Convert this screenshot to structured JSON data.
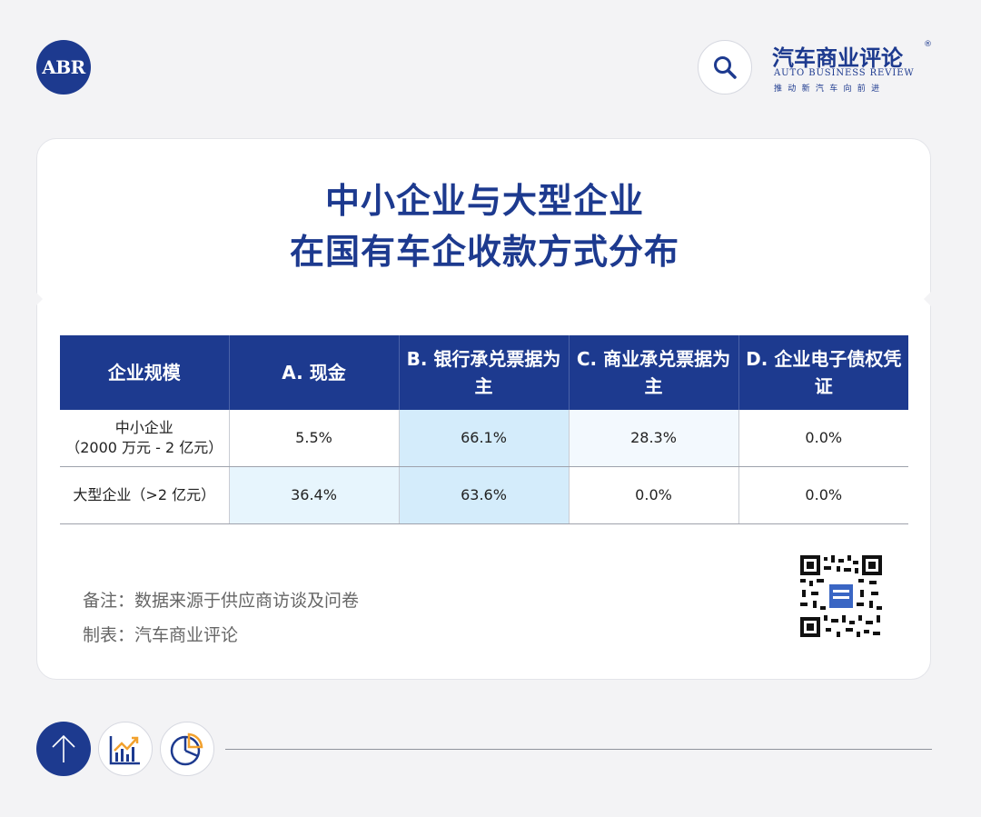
{
  "header": {
    "logo_text": "ABR",
    "brand_name": "汽车商业评论",
    "brand_registered": "®",
    "brand_english": "AUTO BUSINESS REVIEW",
    "brand_slogan": "推动新汽车向前进"
  },
  "card": {
    "title_line1": "中小企业与大型企业",
    "title_line2": "在国有车企收款方式分布",
    "table": {
      "headers": [
        "企业规模",
        "A. 现金",
        "B. 银行承兑票据为主",
        "C. 商业承兑票据为主",
        "D. 企业电子债权凭证"
      ],
      "rows": [
        {
          "scale_line1": "中小企业",
          "scale_line2": "（2000 万元 - 2 亿元）",
          "values": [
            "5.5%",
            "66.1%",
            "28.3%",
            "0.0%"
          ]
        },
        {
          "scale_line1": "大型企业（>2 亿元）",
          "scale_line2": "",
          "values": [
            "36.4%",
            "63.6%",
            "0.0%",
            "0.0%"
          ]
        }
      ]
    },
    "note_source": "备注：数据来源于供应商访谈及问卷",
    "note_maker": "制表：汽车商业评论"
  },
  "icons": {
    "search": "search-icon",
    "qr": "qr-code-icon",
    "up": "arrow-up-icon",
    "line": "line-chart-icon",
    "pie": "pie-chart-icon"
  },
  "colors": {
    "brand": "#1d3a8f",
    "highlight_strong": "#d4ecfb",
    "highlight_light": "#e7f5fd",
    "background": "#f3f3f5"
  }
}
